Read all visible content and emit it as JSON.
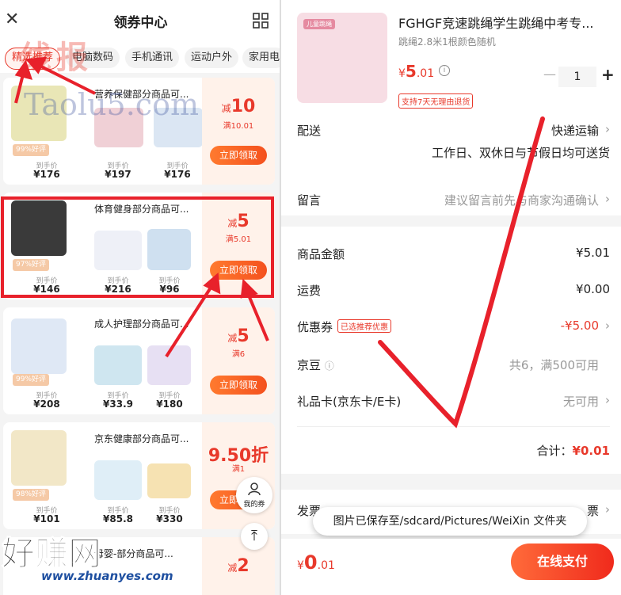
{
  "left": {
    "header": {
      "title": "领券中心"
    },
    "tabs": [
      "精选推荐",
      "电脑数码",
      "手机通讯",
      "运动户外",
      "家用电"
    ],
    "cards": [
      {
        "title": "营养保健部分商品可...",
        "rating": "99%好评",
        "label": "到手价",
        "prices": [
          "¥176",
          "¥197",
          "¥176"
        ],
        "amount_prefix": "减",
        "amount": "10",
        "cond": "满10.01",
        "button": "立即领取"
      },
      {
        "title": "体育健身部分商品可...",
        "rating": "97%好评",
        "label": "到手价",
        "prices": [
          "¥146",
          "¥216",
          "¥96"
        ],
        "amount_prefix": "减",
        "amount": "5",
        "cond": "满5.01",
        "button": "立即领取"
      },
      {
        "title": "成人护理部分商品可...",
        "rating": "99%好评",
        "label": "到手价",
        "prices": [
          "¥208",
          "¥33.9",
          "¥180"
        ],
        "amount_prefix": "减",
        "amount": "5",
        "cond": "满6",
        "button": "立即领取"
      },
      {
        "title": "京东健康部分商品可...",
        "rating": "98%好评",
        "label": "到手价",
        "prices": [
          "¥101",
          "¥85.8",
          "¥330"
        ],
        "amount_prefix": "",
        "amount": "9.50折",
        "cond": "满1",
        "button": "立即领取"
      },
      {
        "title": "母婴-部分商品可...",
        "amount_prefix": "减",
        "amount": "2"
      }
    ],
    "float_mine": "我的券",
    "watermark_top": "线报",
    "watermark_mid": "Taolu5.com",
    "watermark_bottom": "好赚网",
    "watermark_url": "www.zhuanyes.com"
  },
  "right": {
    "product": {
      "img_tag": "儿童跳绳",
      "title": "FGHGF竞速跳绳学生跳绳中考专...",
      "subtitle": "跳绳2.8米1根颜色随机",
      "price_symbol": "¥",
      "price_int": "5",
      "price_dec": ".01",
      "qty": "1",
      "return_badge": "支持7天无理由退货"
    },
    "delivery": {
      "label": "配送",
      "value": "快递运输",
      "note": "工作日、双休日与节假日均可送货"
    },
    "message": {
      "label": "留言",
      "placeholder": "建议留言前先与商家沟通确认"
    },
    "summary": {
      "goods_label": "商品金额",
      "goods_value": "¥5.01",
      "freight_label": "运费",
      "freight_value": "¥0.00",
      "coupon_label": "优惠券",
      "coupon_pill": "已选推荐优惠",
      "coupon_value": "-¥5.00",
      "bean_label": "京豆",
      "bean_value": "共6，满500可用",
      "gift_label": "礼品卡(京东卡/E卡)",
      "gift_value": "无可用",
      "total_label": "合计：",
      "total_value": "¥0.01"
    },
    "invoice_label": "发票",
    "invoice_value": "票",
    "toast": "图片已保存至/sdcard/Pictures/WeiXin 文件夹",
    "bottom": {
      "symbol": "¥",
      "int": "0",
      "dec": ".01",
      "pay_button": "在线支付"
    }
  }
}
